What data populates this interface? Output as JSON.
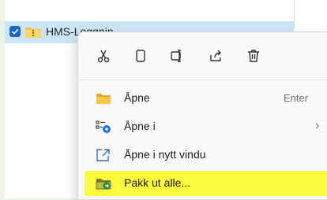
{
  "file": {
    "name": "HMS-Loggpin"
  },
  "toolbar": {
    "icons": [
      "cut-icon",
      "copy-icon",
      "rename-icon",
      "share-icon",
      "delete-icon"
    ]
  },
  "menu": {
    "items": [
      {
        "label": "Åpne",
        "shortcut": "Enter",
        "icon": "folder-icon"
      },
      {
        "label": "Åpne i",
        "has_submenu": true,
        "icon": "open-with-icon"
      },
      {
        "label": "Åpne i nytt vindu",
        "icon": "new-window-icon"
      },
      {
        "label": "Pakk ut alle...",
        "icon": "extract-icon",
        "highlighted": true
      }
    ]
  },
  "colors": {
    "highlight": "#fbfb3c",
    "selection": "#cde6f7",
    "checkbox": "#1a66c4",
    "background": "#e9f3e6"
  }
}
